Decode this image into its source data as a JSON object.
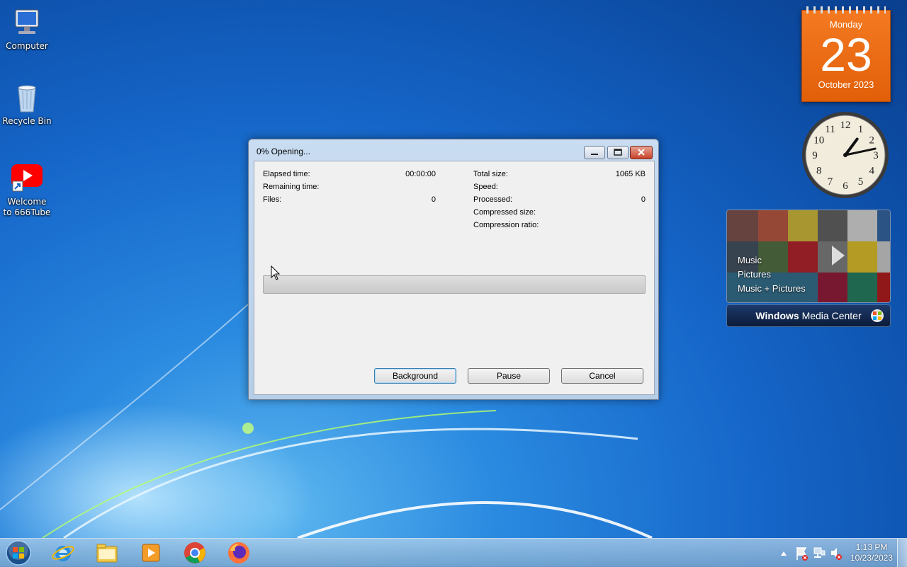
{
  "desktop": {
    "icons": [
      {
        "label": "Computer"
      },
      {
        "label": "Recycle Bin"
      },
      {
        "label": "Welcome to 666Tube"
      }
    ]
  },
  "gadgets": {
    "calendar": {
      "weekday": "Monday",
      "day": "23",
      "month_year": "October 2023"
    },
    "clock": {
      "numbers": [
        "12",
        "1",
        "2",
        "3",
        "4",
        "5",
        "6",
        "7",
        "8",
        "9",
        "10",
        "11"
      ],
      "hour": 1,
      "minute": 13
    },
    "media_center": {
      "menu": [
        "Music",
        "Pictures",
        "Music + Pictures"
      ],
      "brand_bold": "Windows",
      "brand_rest": " Media Center"
    }
  },
  "dialog": {
    "title": "0% Opening...",
    "left_stats": [
      {
        "label": "Elapsed time:",
        "value": "00:00:00"
      },
      {
        "label": "Remaining time:",
        "value": ""
      },
      {
        "label": "Files:",
        "value": "0"
      }
    ],
    "right_stats": [
      {
        "label": "Total size:",
        "value": "1065 KB"
      },
      {
        "label": "Speed:",
        "value": ""
      },
      {
        "label": "Processed:",
        "value": "0"
      },
      {
        "label": "Compressed size:",
        "value": ""
      },
      {
        "label": "Compression ratio:",
        "value": ""
      }
    ],
    "progress_percent": 0,
    "buttons": {
      "background": "Background",
      "pause": "Pause",
      "cancel": "Cancel"
    }
  },
  "taskbar": {
    "pinned": [
      "start-orb-icon",
      "internet-explorer-icon",
      "file-explorer-icon",
      "media-player-icon",
      "chrome-icon",
      "firefox-icon"
    ],
    "tray_time": "1:13 PM",
    "tray_date": "10/23/2023"
  }
}
